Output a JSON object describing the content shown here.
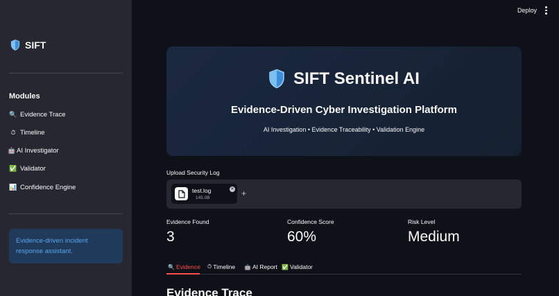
{
  "sidebar": {
    "brand": {
      "icon": "shield-icon",
      "title": "SIFT"
    },
    "modules_heading": "Modules",
    "items": [
      {
        "icon": "magnifier-emoji",
        "glyph": "🔍",
        "label": "Evidence Trace"
      },
      {
        "icon": "stopwatch-emoji",
        "glyph": "⏱",
        "label": "Timeline"
      },
      {
        "icon": "robot-emoji",
        "glyph": "🤖",
        "label": "AI Investigator"
      },
      {
        "icon": "check-mark-emoji",
        "glyph": "✅",
        "label": "Validator"
      },
      {
        "icon": "bar-chart-emoji",
        "glyph": "📊",
        "label": "Confidence Engine"
      }
    ],
    "info_text": "Evidence-driven incident response assistant."
  },
  "topbar": {
    "deploy_label": "Deploy",
    "menu_icon": "vertical-dots-icon"
  },
  "hero": {
    "icon": "shield-icon",
    "title": "SIFT Sentinel AI",
    "subtitle": "Evidence-Driven Cyber Investigation Platform",
    "tagline": "AI Investigation • Evidence Traceability • Validation Engine"
  },
  "uploader": {
    "label": "Upload Security Log",
    "file": {
      "name": "test.log",
      "size": "145.0B"
    }
  },
  "metrics": [
    {
      "label": "Evidence Found",
      "value": "3"
    },
    {
      "label": "Confidence Score",
      "value": "60%"
    },
    {
      "label": "Risk Level",
      "value": "Medium"
    }
  ],
  "tabs": [
    {
      "glyph": "🔍",
      "label": "Evidence",
      "active": true
    },
    {
      "glyph": "⏱",
      "label": "Timeline",
      "active": false
    },
    {
      "glyph": "🤖",
      "label": "AI Report",
      "active": false
    },
    {
      "glyph": "✅",
      "label": "Validator",
      "active": false
    }
  ],
  "section_heading": "Evidence Trace",
  "colors": {
    "background": "#0e1117",
    "sidebar": "#262730",
    "accent": "#ff4b4b",
    "info_bg": "#1f3a5a",
    "info_text": "#5aa7ec",
    "shield_blue": "#3b8fd8"
  }
}
